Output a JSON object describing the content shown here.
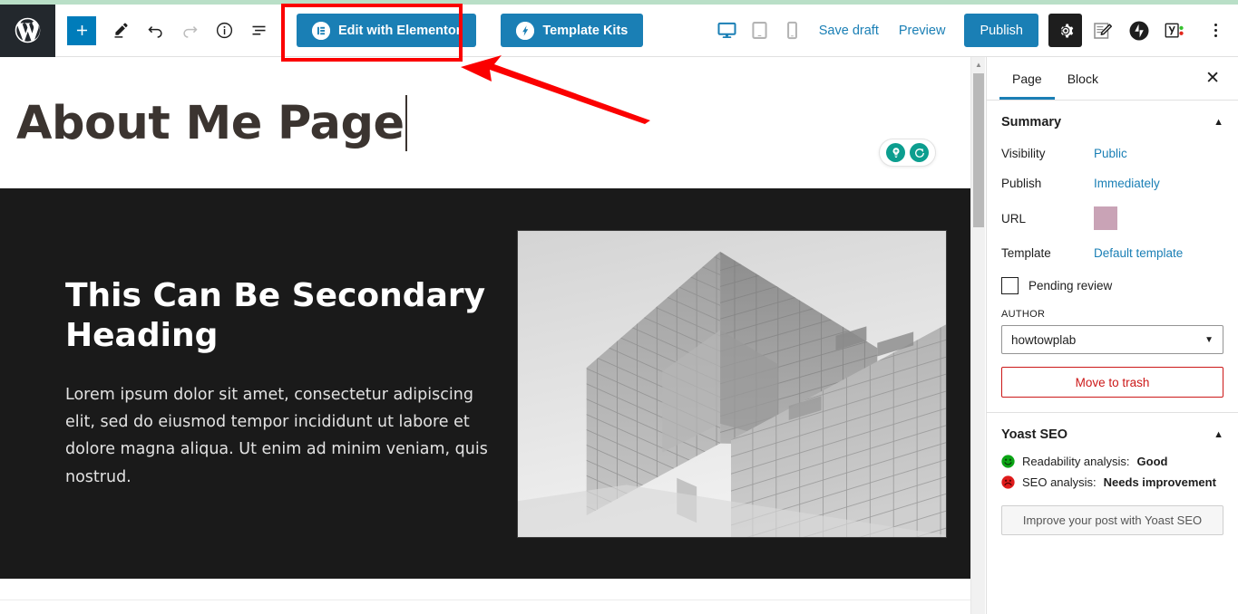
{
  "toolbar": {
    "wp_logo": "wordpress-logo",
    "add_block_label": "+",
    "edit_label": "pencil-icon",
    "undo_label": "undo-icon",
    "redo_label": "redo-icon",
    "details_label": "info-icon",
    "outline_label": "list-view-icon",
    "elementor_button": "Edit with Elementor",
    "template_kits_button": "Template Kits",
    "device_desktop": "desktop-icon",
    "device_tablet": "tablet-icon",
    "device_mobile": "mobile-icon",
    "save_draft": "Save draft",
    "preview": "Preview",
    "publish": "Publish",
    "settings": "gear-icon",
    "jetpack": "jetpack-icon",
    "yoast": "yoast-icon",
    "more_options": "kebab-menu-icon",
    "accent_blue": "#1a7fb5",
    "publish_blue": "#1a7fb5"
  },
  "canvas": {
    "page_title": "About Me Page",
    "float_tools": {
      "idea_icon": "lightbulb-plus-icon",
      "refresh_icon": "refresh-icon",
      "color": "#0c9e8f"
    },
    "hero": {
      "heading": "This Can Be Secondary Heading",
      "paragraph": "Lorem ipsum dolor sit amet, consectetur adipiscing elit, sed do eiusmod tempor incididunt ut labore et dolore magna aliqua. Ut enim ad minim veniam, quis nostrud.",
      "image_alt": "grayscale-modern-glass-office-building",
      "background_color": "#1a1a1a"
    }
  },
  "sidebar": {
    "tabs": [
      {
        "label": "Page",
        "active": true
      },
      {
        "label": "Block",
        "active": false
      }
    ],
    "close_label": "✕",
    "summary": {
      "title": "Summary",
      "collapse_icon": "chevron-up-icon",
      "rows": [
        {
          "label": "Visibility",
          "value": "Public"
        },
        {
          "label": "Publish",
          "value": "Immediately"
        },
        {
          "label": "URL",
          "value": ""
        },
        {
          "label": "Template",
          "value": "Default template"
        }
      ],
      "pending_review": "Pending review",
      "author_label": "AUTHOR",
      "author_value": "howtowplab",
      "trash_label": "Move to trash",
      "trash_color": "#cc1818"
    },
    "yoast": {
      "title": "Yoast SEO",
      "collapse_icon": "chevron-up-icon",
      "readability_prefix": "Readability analysis:",
      "readability_value": "Good",
      "seo_prefix": "SEO analysis:",
      "seo_value": "Needs improvement",
      "improve_button": "Improve your post with Yoast SEO",
      "good_color": "#00a32a",
      "bad_color": "#dc3232"
    }
  },
  "annotations": {
    "highlight_rect": "red-highlight-rectangle",
    "arrow": "red-pointer-arrow",
    "color": "#fb0000"
  }
}
